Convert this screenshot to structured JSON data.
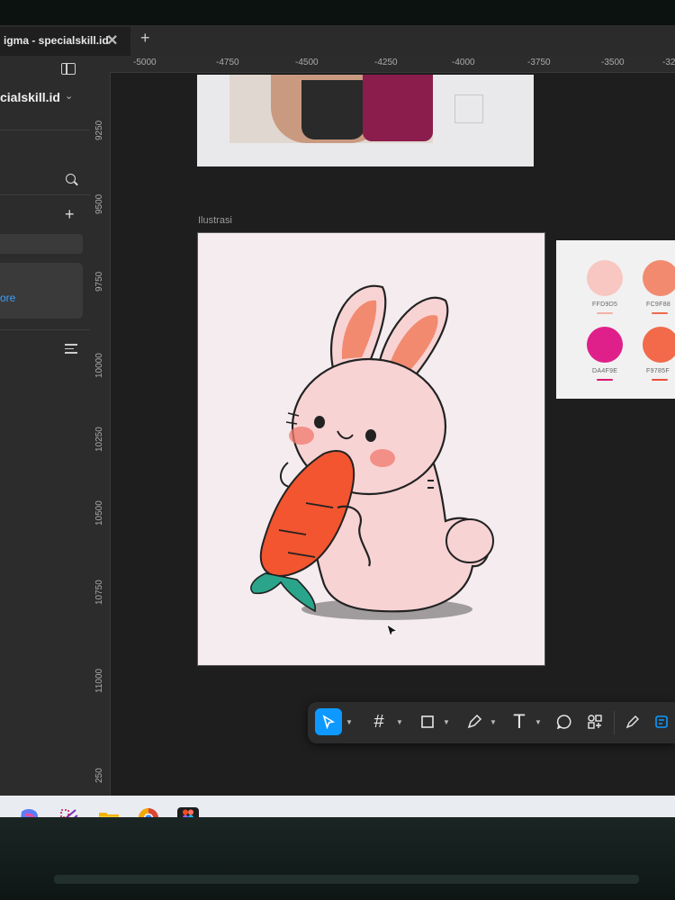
{
  "browser": {
    "tab_title": "igma - specialskill.id",
    "tab_close": "✕",
    "new_tab": "+"
  },
  "left_panel": {
    "file_name": "cialskill.id",
    "file_chevron": "⌄",
    "add_label": "+",
    "explore_link": "ore"
  },
  "ruler": {
    "top_ticks": [
      "-5000",
      "-4750",
      "-4500",
      "-4250",
      "-4000",
      "-3750",
      "-3500",
      "-32"
    ],
    "left_ticks": [
      "9250",
      "9500",
      "9750",
      "10000",
      "10250",
      "10500",
      "10750",
      "11000",
      "250"
    ]
  },
  "canvas": {
    "frame_label": "Ilustrasi",
    "palette": [
      {
        "hex": "FFD9D5",
        "color": "#f8c7c2",
        "bar": "#f3b0a8"
      },
      {
        "hex": "FC9F88",
        "color": "#f28a70",
        "bar": "#ee6a4e"
      },
      {
        "hex": "DA4F9E",
        "color": "#e0208a",
        "bar": "#d6186f"
      },
      {
        "hex": "F9785F",
        "color": "#f26a4a",
        "bar": "#e8503a"
      }
    ]
  },
  "toolbar": {
    "tools": [
      "move-tool",
      "frame-tool",
      "shape-tool",
      "pen-tool",
      "text-tool",
      "comment-tool",
      "actions-tool"
    ],
    "text_glyph": "T",
    "frame_glyph": "#"
  },
  "taskbar": {
    "apps": [
      "copilot",
      "snipping-tool",
      "file-explorer",
      "chrome",
      "figma"
    ]
  }
}
